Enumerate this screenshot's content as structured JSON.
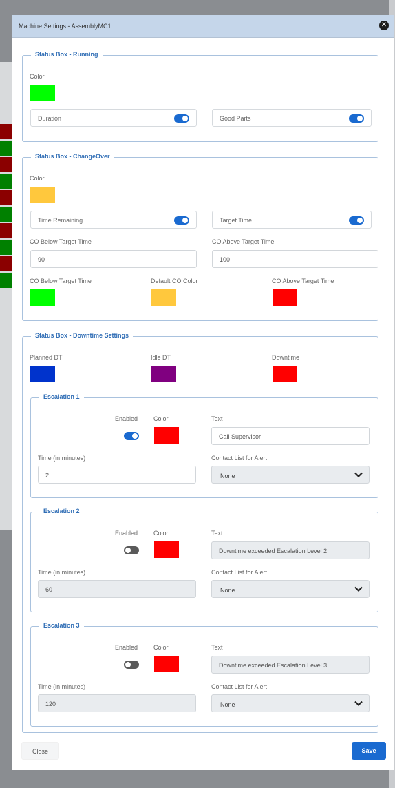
{
  "dialog": {
    "title": "Machine Settings - AssemblyMC1",
    "close_icon": "close-icon"
  },
  "running": {
    "legend": "Status Box - Running",
    "color_label": "Color",
    "color": "#00ff00",
    "duration_label": "Duration",
    "duration_on": true,
    "good_parts_label": "Good Parts",
    "good_parts_on": true
  },
  "changeover": {
    "legend": "Status Box - ChangeOver",
    "color_label": "Color",
    "color": "#ffc83d",
    "time_remaining_label": "Time Remaining",
    "time_remaining_on": true,
    "target_time_label": "Target Time",
    "target_time_on": true,
    "co_below_label": "CO Below Target Time",
    "co_below_value": "90",
    "co_above_label": "CO Above Target Time",
    "co_above_value": "100",
    "co_below_color_label": "CO Below Target Time",
    "co_below_color": "#00ff00",
    "default_co_color_label": "Default CO Color",
    "default_co_color": "#ffc83d",
    "co_above_color_label": "CO Above Target Time",
    "co_above_color": "#ff0000"
  },
  "downtime": {
    "legend": "Status Box - Downtime Settings",
    "planned_label": "Planned DT",
    "planned_color": "#0033cc",
    "idle_label": "Idle DT",
    "idle_color": "#800080",
    "downtime_label": "Downtime",
    "downtime_color": "#ff0000",
    "escalations": [
      {
        "legend": "Escalation 1",
        "enabled_label": "Enabled",
        "enabled": true,
        "color_label": "Color",
        "color": "#ff0000",
        "text_label": "Text",
        "text_value": "Call Supervisor",
        "time_label": "Time (in minutes)",
        "time_value": "2",
        "contact_label": "Contact List for Alert",
        "contact_value": "None"
      },
      {
        "legend": "Escalation 2",
        "enabled_label": "Enabled",
        "enabled": false,
        "color_label": "Color",
        "color": "#ff0000",
        "text_label": "Text",
        "text_value": "Downtime exceeded Escalation Level 2",
        "time_label": "Time (in minutes)",
        "time_value": "60",
        "contact_label": "Contact List for Alert",
        "contact_value": "None"
      },
      {
        "legend": "Escalation 3",
        "enabled_label": "Enabled",
        "enabled": false,
        "color_label": "Color",
        "color": "#ff0000",
        "text_label": "Text",
        "text_value": "Downtime exceeded Escalation Level 3",
        "time_label": "Time (in minutes)",
        "time_value": "120",
        "contact_label": "Contact List for Alert",
        "contact_value": "None"
      }
    ]
  },
  "footer": {
    "close_label": "Close",
    "save_label": "Save"
  },
  "accent": "#1a6ad0",
  "background_row_colors": [
    "#8b0000",
    "#008000"
  ]
}
